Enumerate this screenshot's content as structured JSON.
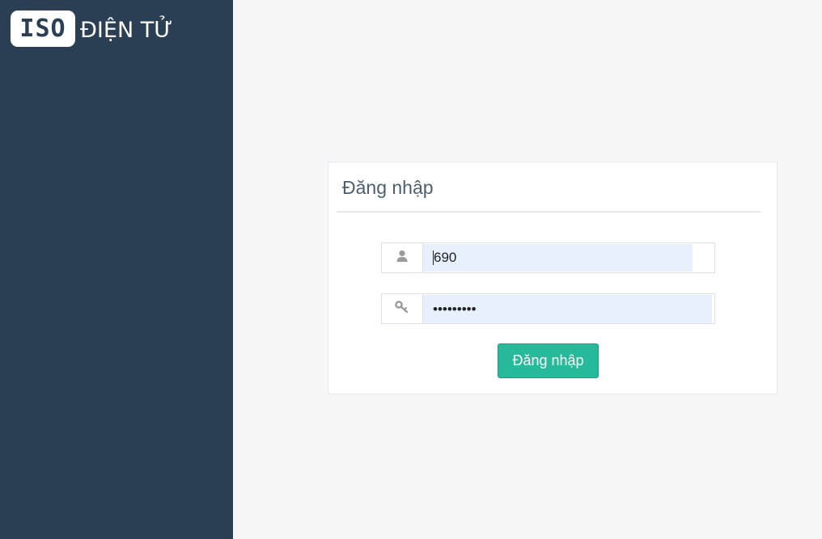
{
  "brand": {
    "logo_text": "ISO",
    "name": "ĐIỆN TỬ",
    "logo_bg": "#ffffff",
    "sidebar_bg": "#2a3f54"
  },
  "login": {
    "title": "Đăng nhập",
    "username": {
      "value": "690",
      "icon": "user-icon"
    },
    "password": {
      "value": "•••••••••",
      "icon": "key-icon"
    },
    "submit_label": "Đăng nhập",
    "accent": "#26b99a"
  }
}
